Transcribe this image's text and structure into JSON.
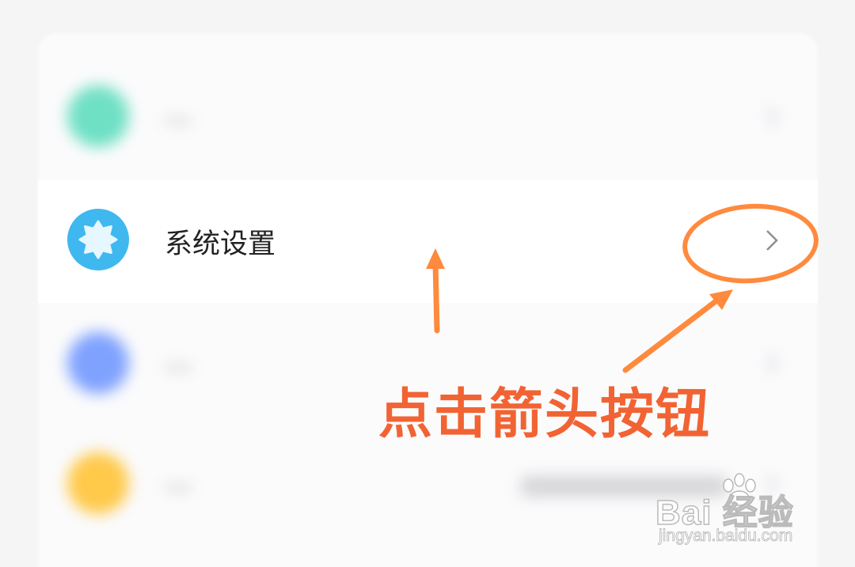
{
  "settings_list": {
    "items": [
      {
        "label": "...",
        "icon": "teal-circle-icon",
        "icon_color": "#6fe0c4",
        "blurred": true
      },
      {
        "label": "系统设置",
        "icon": "settings-gear-icon",
        "icon_color": "#3fb8f0",
        "blurred": false
      },
      {
        "label": "...",
        "icon": "blue-circle-icon",
        "icon_color": "#7fa2ff",
        "blurred": true
      },
      {
        "label": "...",
        "icon": "yellow-circle-icon",
        "icon_color": "#ffc94a",
        "blurred": true
      }
    ]
  },
  "annotation": {
    "text": "点击箭头按钮",
    "color": "#f26333"
  },
  "watermark": {
    "logo": "Bai 经验",
    "url": "jingyan.baidu.com"
  }
}
